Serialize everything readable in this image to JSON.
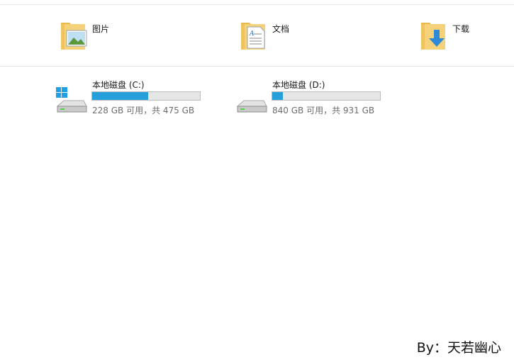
{
  "folders": [
    {
      "label": "图片",
      "icon": "pictures-folder-icon"
    },
    {
      "label": "文档",
      "icon": "documents-folder-icon"
    },
    {
      "label": "下载",
      "icon": "downloads-folder-icon"
    }
  ],
  "drives": [
    {
      "name": "本地磁盘 (C:)",
      "space": "228 GB 可用，共 475 GB",
      "used_fraction": 0.52,
      "icon": "windows-drive-icon"
    },
    {
      "name": "本地磁盘 (D:)",
      "space": "840 GB 可用，共 931 GB",
      "used_fraction": 0.1,
      "icon": "hard-drive-icon"
    }
  ],
  "colors": {
    "accent": "#26a0da",
    "bar_track": "#e6e6e6",
    "folder": "#f5d27a",
    "windows_logo": "#1fa0e4"
  },
  "watermark": "By：天若幽心"
}
